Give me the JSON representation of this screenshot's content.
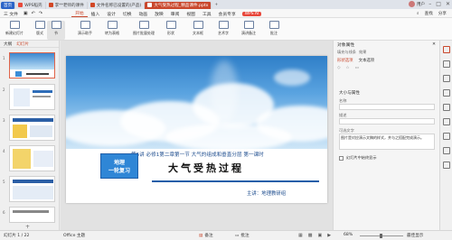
{
  "titlebar": {
    "home_tab": "首页",
    "tabs": [
      "WPS稻壳",
      "李**老师的课件",
      "文件名称已设置的(产品)",
      "大气受热过程_精品课件.pptx"
    ],
    "window_buttons": [
      "minimize-icon",
      "maximize-icon",
      "close-icon"
    ],
    "user": "用户"
  },
  "menu": {
    "file": "三 文件",
    "items": [
      "开始",
      "插入",
      "设计",
      "切换",
      "动画",
      "放映",
      "审阅",
      "视图",
      "工具",
      "会员专享"
    ],
    "active": "开始",
    "ai_label": "WPS AI",
    "right_items": [
      "查找",
      "分享"
    ]
  },
  "ribbon": {
    "buttons": [
      "新建幻灯片",
      "版式",
      "节",
      "演示助手",
      "转为表格",
      "图片批量处理",
      "形状",
      "文本框",
      "艺术字",
      "演讲备注",
      "批注"
    ]
  },
  "slide_pane": {
    "header": "大纲",
    "header2": "幻灯片",
    "slide_numbers": [
      "1",
      "2",
      "3",
      "4",
      "5",
      "6"
    ],
    "add_label": "+"
  },
  "slide": {
    "subtitle": "第5讲 必修1第二章第一节 大气的组成和垂直分层 第一课时",
    "title": "大气受热过程",
    "badge_line1": "地理",
    "badge_line2": "一轮复习",
    "author": "主讲：地理教研组"
  },
  "right_panel": {
    "title": "对象属性",
    "tabs": [
      "填充与线条",
      "效果",
      "大小与属性"
    ],
    "section1": "形状选项",
    "section2": "文本选项",
    "label_name": "名称",
    "label_desc": "描述",
    "name_value": "",
    "desc_value": "",
    "alt_text_label": "可选文字",
    "alt_text_value": "图片是对应演示文稿的样式，并与之搭配完成演示。",
    "checkbox_label": "幻灯片中始终显示"
  },
  "status": {
    "slide_info": "幻灯片 1 / 22",
    "theme": "Office 主题",
    "notes": "备注",
    "comment": "批注",
    "zoom": "68%",
    "fit": "最佳显示"
  }
}
